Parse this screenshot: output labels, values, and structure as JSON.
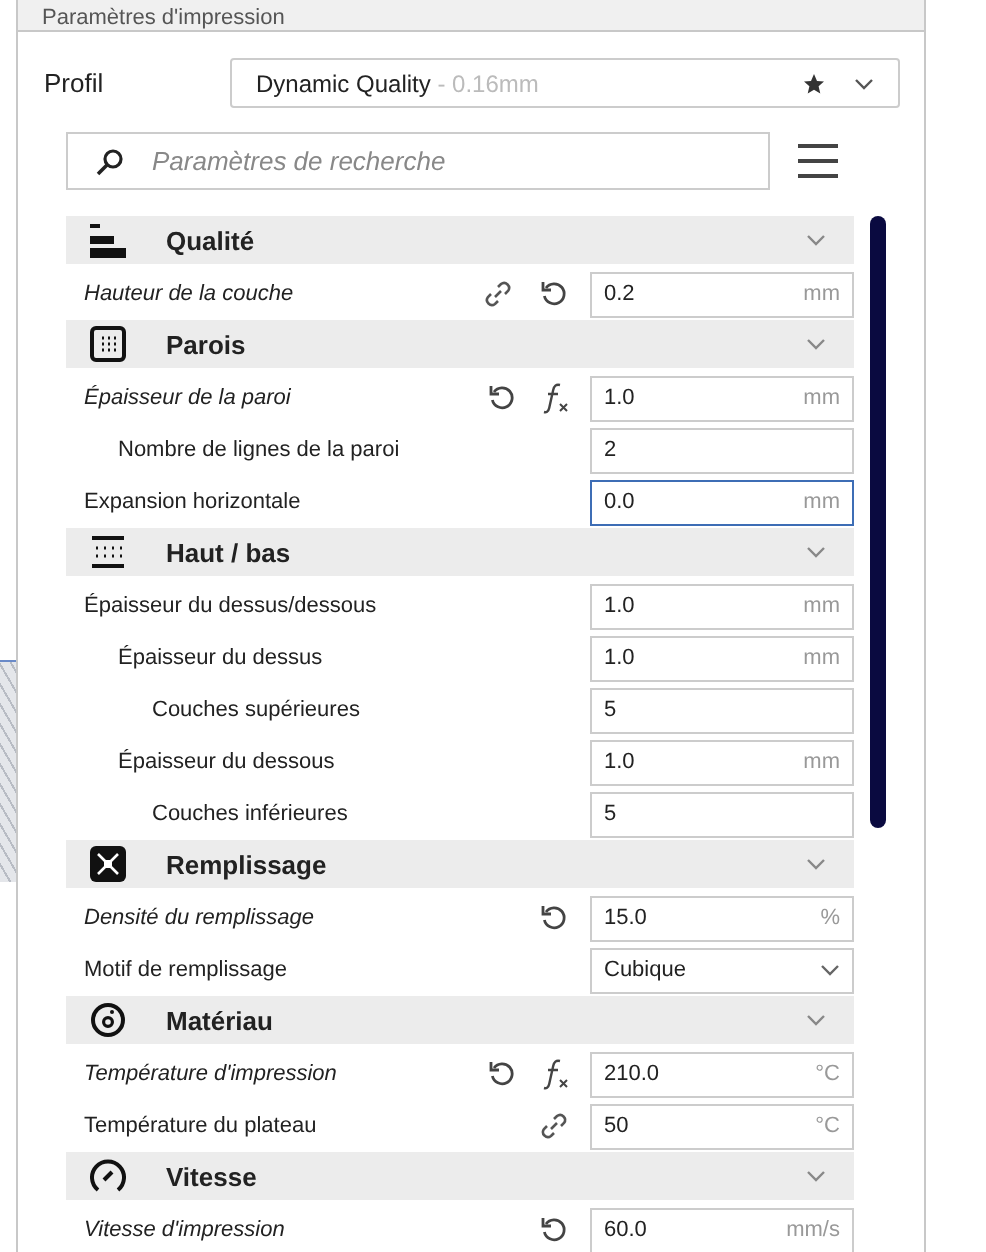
{
  "window": {
    "title": "Paramètres d'impression"
  },
  "profile": {
    "label": "Profil",
    "name": "Dynamic Quality",
    "detail": " - 0.16mm"
  },
  "search": {
    "placeholder": "Paramètres de recherche"
  },
  "sections": [
    {
      "title": "Qualité",
      "settings": [
        {
          "kind": "text",
          "label": "Hauteur de la couche",
          "user_set": true,
          "linked": true,
          "resettable": true,
          "formula": false,
          "value": "0.2",
          "unit": "mm",
          "focused": false
        }
      ]
    },
    {
      "title": "Parois",
      "settings": [
        {
          "kind": "text",
          "label": "Épaisseur de la paroi",
          "user_set": true,
          "linked": false,
          "resettable": true,
          "formula": true,
          "value": "1.0",
          "unit": "mm",
          "focused": false,
          "children": [
            {
              "kind": "text",
              "label": "Nombre de lignes de la paroi",
              "user_set": false,
              "linked": false,
              "resettable": false,
              "formula": false,
              "value": "2",
              "focused": false
            }
          ]
        },
        {
          "kind": "text",
          "label": "Expansion horizontale",
          "user_set": false,
          "linked": false,
          "resettable": false,
          "formula": false,
          "value": "0.0",
          "unit": "mm",
          "focused": true
        }
      ]
    },
    {
      "title": "Haut / bas",
      "settings": [
        {
          "kind": "text",
          "label": "Épaisseur du dessus/dessous",
          "user_set": false,
          "linked": false,
          "resettable": false,
          "formula": false,
          "value": "1.0",
          "unit": "mm",
          "focused": false,
          "children": [
            {
              "kind": "text",
              "label": "Épaisseur du dessus",
              "user_set": false,
              "linked": false,
              "resettable": false,
              "formula": false,
              "value": "1.0",
              "unit": "mm",
              "focused": false,
              "children": [
                {
                  "kind": "text",
                  "label": "Couches supérieures",
                  "user_set": false,
                  "linked": false,
                  "resettable": false,
                  "formula": false,
                  "value": "5",
                  "focused": false
                }
              ]
            },
            {
              "kind": "text",
              "label": "Épaisseur du dessous",
              "user_set": false,
              "linked": false,
              "resettable": false,
              "formula": false,
              "value": "1.0",
              "unit": "mm",
              "focused": false,
              "children": [
                {
                  "kind": "text",
                  "label": "Couches inférieures",
                  "user_set": false,
                  "linked": false,
                  "resettable": false,
                  "formula": false,
                  "value": "5",
                  "focused": false
                }
              ]
            }
          ]
        }
      ]
    },
    {
      "title": "Remplissage",
      "settings": [
        {
          "kind": "text",
          "label": "Densité du remplissage",
          "user_set": true,
          "linked": false,
          "resettable": true,
          "formula": false,
          "value": "15.0",
          "unit": "%",
          "focused": false
        },
        {
          "kind": "dropdown",
          "label": "Motif de remplissage",
          "user_set": false,
          "linked": false,
          "resettable": false,
          "formula": false,
          "value": "Cubique",
          "focused": false
        }
      ]
    },
    {
      "title": "Matériau",
      "settings": [
        {
          "kind": "text",
          "label": "Température d'impression",
          "user_set": true,
          "linked": false,
          "resettable": true,
          "formula": true,
          "value": "210.0",
          "unit": "°C",
          "focused": false
        },
        {
          "kind": "text",
          "label": "Température du plateau",
          "user_set": false,
          "linked": true,
          "resettable": false,
          "formula": false,
          "value": "50",
          "unit": "°C",
          "focused": false
        }
      ]
    },
    {
      "title": "Vitesse",
      "settings": [
        {
          "kind": "text",
          "label": "Vitesse d'impression",
          "user_set": true,
          "linked": false,
          "resettable": true,
          "formula": false,
          "value": "60.0",
          "unit": "mm/s",
          "focused": false
        }
      ]
    }
  ]
}
